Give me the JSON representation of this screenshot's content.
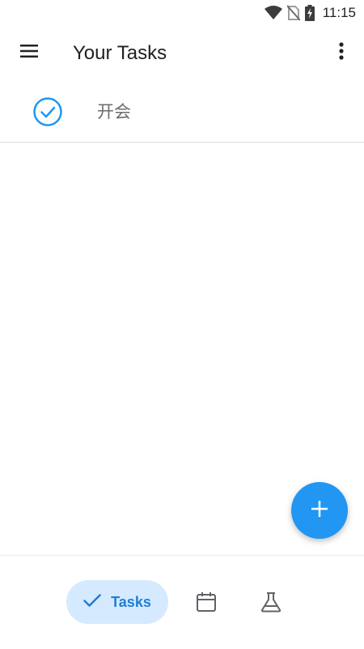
{
  "status_bar": {
    "time": "11:15",
    "icons": [
      "wifi-icon",
      "no-sim-icon",
      "battery-charging-icon"
    ]
  },
  "app_bar": {
    "title": "Your Tasks",
    "menu_icon": "hamburger-menu-icon",
    "more_icon": "more-vertical-icon"
  },
  "tasks": [
    {
      "label": "开会",
      "completed": true
    }
  ],
  "fab": {
    "icon": "plus-icon"
  },
  "bottom_nav": {
    "items": [
      {
        "label": "Tasks",
        "icon": "check-icon",
        "active": true
      },
      {
        "label": "",
        "icon": "calendar-icon",
        "active": false
      },
      {
        "label": "",
        "icon": "flask-icon",
        "active": false
      }
    ]
  },
  "colors": {
    "accent": "#2196f3",
    "nav_active_bg": "#d6eaff",
    "nav_active_text": "#1f7fd4",
    "icon_gray": "#5f6368"
  }
}
